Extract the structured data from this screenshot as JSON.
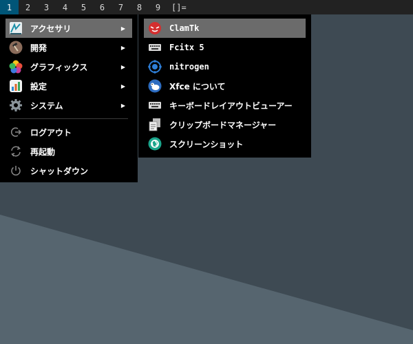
{
  "topbar": {
    "workspaces": [
      "1",
      "2",
      "3",
      "4",
      "5",
      "6",
      "7",
      "8",
      "9"
    ],
    "active_workspace": "1",
    "layout_symbol": "[]="
  },
  "main_menu": {
    "items": [
      {
        "label": "アクセサリ",
        "icon": "accessories-icon",
        "has_submenu": true
      },
      {
        "label": "開発",
        "icon": "development-icon",
        "has_submenu": true
      },
      {
        "label": "グラフィックス",
        "icon": "graphics-icon",
        "has_submenu": true
      },
      {
        "label": "設定",
        "icon": "settings-icon",
        "has_submenu": true
      },
      {
        "label": "システム",
        "icon": "system-gear-icon",
        "has_submenu": true
      }
    ],
    "actions": [
      {
        "label": "ログアウト",
        "icon": "logout-icon"
      },
      {
        "label": "再起動",
        "icon": "restart-icon"
      },
      {
        "label": "シャットダウン",
        "icon": "power-icon"
      }
    ]
  },
  "sub_menu": {
    "items": [
      {
        "label": "ClamTk",
        "icon": "clamtk-icon"
      },
      {
        "label": "Fcitx 5",
        "icon": "keyboard-icon"
      },
      {
        "label": "nitrogen",
        "icon": "nitrogen-icon"
      },
      {
        "label": "Xfce について",
        "icon": "xfce-mouse-icon"
      },
      {
        "label": "キーボードレイアウトビューアー",
        "icon": "keyboard-layout-icon"
      },
      {
        "label": "クリップボードマネージャー",
        "icon": "clipboard-icon"
      },
      {
        "label": "スクリーンショット",
        "icon": "screenshot-icon"
      }
    ]
  },
  "colors": {
    "topbar_bg": "#222222",
    "active_workspace_bg": "#005577",
    "menu_bg": "#000000",
    "selected_bg": "#6b6b6b",
    "desktop_dark": "#3e4a53",
    "desktop_light": "#56656f"
  }
}
